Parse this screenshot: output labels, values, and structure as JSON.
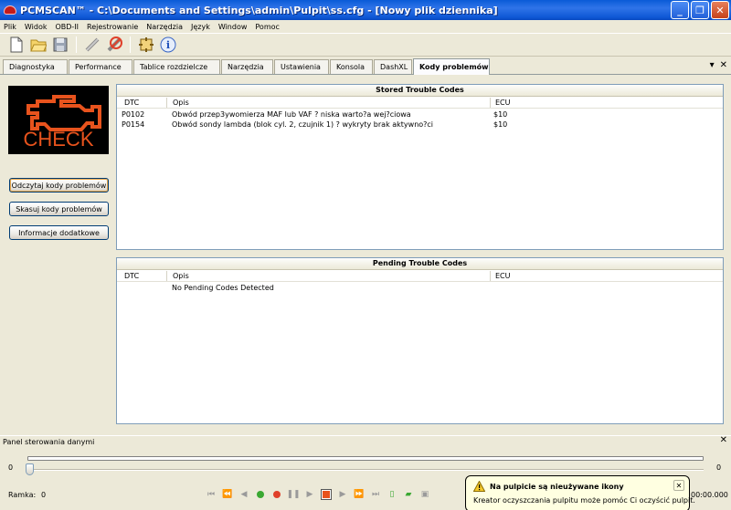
{
  "window": {
    "title": "PCMSCAN™ - C:\\Documents and Settings\\admin\\Pulpit\\ss.cfg - [Nowy plik dziennika]",
    "minimize": "_",
    "maximize": "❐",
    "close": "✕"
  },
  "menu": [
    "Plik",
    "Widok",
    "OBD-II",
    "Rejestrowanie",
    "Narzędzia",
    "Język",
    "Window",
    "Pomoc"
  ],
  "toolbar": {
    "icons": [
      "new-file-icon",
      "open-folder-icon",
      "save-disk-icon",
      "connect-icon",
      "disconnect-icon",
      "settings-icon",
      "info-icon"
    ],
    "info_glyph": "i"
  },
  "tabs": [
    "Diagnostyka",
    "Performance",
    "Tablice rozdzielcze",
    "Narzędzia",
    "Ustawienia",
    "Konsola",
    "DashXL",
    "Kody problemów"
  ],
  "tab_controls": {
    "dropdown": "▾",
    "close": "✕"
  },
  "check_engine": {
    "label": "CHECK"
  },
  "actions": {
    "read_codes": "Odczytaj kody problemów",
    "clear_codes": "Skasuj kody problemów",
    "additional_info": "Informacje dodatkowe"
  },
  "stored": {
    "title": "Stored Trouble Codes",
    "columns": {
      "dtc": "DTC",
      "desc": "Opis",
      "ecu": "ECU"
    },
    "rows": [
      {
        "dtc": "P0102",
        "desc": "Obwód przep3ywomierza MAF lub VAF ? niska warto?a wej?ciowa",
        "ecu": "$10"
      },
      {
        "dtc": "P0154",
        "desc": "Obwód sondy lambda (blok cyl. 2, czujnik 1) ? wykryty brak aktywno?ci",
        "ecu": "$10"
      }
    ]
  },
  "pending": {
    "title": "Pending Trouble Codes",
    "columns": {
      "dtc": "DTC",
      "desc": "Opis",
      "ecu": "ECU"
    },
    "rows": [
      {
        "dtc": "",
        "desc": "No Pending Codes Detected",
        "ecu": ""
      }
    ]
  },
  "data_panel": {
    "title": "Panel sterowania danymi",
    "close": "✕",
    "slider_min": "0",
    "slider_max": "0",
    "frame_label": "Ramka:",
    "frame_value": "0",
    "time": "00:00.000"
  },
  "balloon": {
    "title": "Na pulpicie są nieużywane ikony",
    "text": "Kreator oczyszczania pulpitu może pomóc Ci oczyścić pulpit.",
    "close": "✕"
  },
  "colors": {
    "engine_icon": "#e8531d",
    "record_green": "#3aa832",
    "record_red": "#e0402a"
  }
}
